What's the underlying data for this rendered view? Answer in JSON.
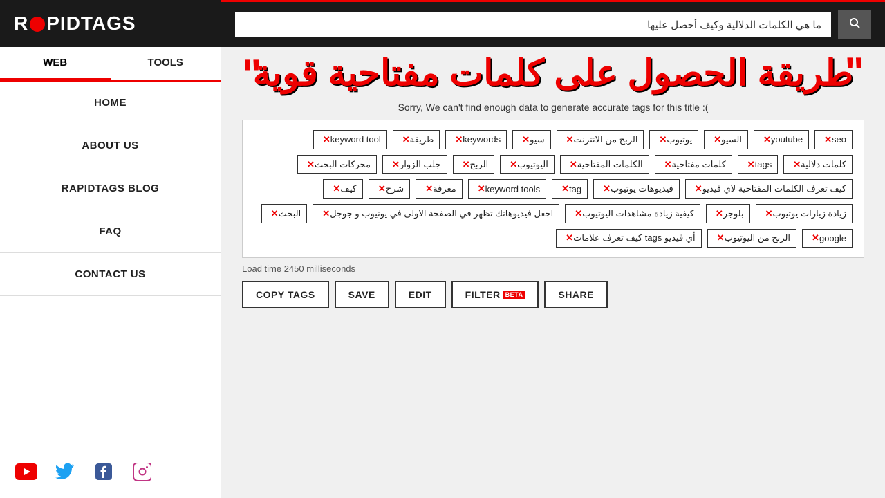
{
  "logo": {
    "text_before": "R",
    "text_after": "PIDTAGS"
  },
  "nav": {
    "tabs": [
      {
        "label": "WEB",
        "active": true
      },
      {
        "label": "TOOLS",
        "active": false
      }
    ],
    "menu_items": [
      {
        "label": "HOME"
      },
      {
        "label": "ABOUT US"
      },
      {
        "label": "RAPIDTAGS BLOG"
      },
      {
        "label": "FAQ"
      },
      {
        "label": "CONTACT US"
      }
    ]
  },
  "search": {
    "placeholder": "ما هي الكلمات الدلالية وكيف أحصل عليها",
    "value": "ما هي الكلمات الدلالية وكيف أحصل عليها"
  },
  "headline": {
    "arabic": "طريقة الحصول على كلمات مفتاحية قوية"
  },
  "sorry_message": "Sorry, We can't find enough data to generate accurate tags for this title :(",
  "tags": [
    {
      "text": "seo"
    },
    {
      "text": "youtube"
    },
    {
      "text": "السيو"
    },
    {
      "text": "يوتيوب"
    },
    {
      "text": "الربح من الانترنت"
    },
    {
      "text": "سيو"
    },
    {
      "text": "keywords"
    },
    {
      "text": "طريقة"
    },
    {
      "text": "keyword tool"
    },
    {
      "text": "كلمات دلالية"
    },
    {
      "text": "tags"
    },
    {
      "text": "كلمات مفتاحية"
    },
    {
      "text": "الكلمات المفتاحية"
    },
    {
      "text": "اليوتيوب"
    },
    {
      "text": "الربح"
    },
    {
      "text": "جلب الزوار"
    },
    {
      "text": "محركات البحث"
    },
    {
      "text": "كيف تعرف الكلمات المفتاحية لاي فيديو"
    },
    {
      "text": "فيديوهات يوتيوب"
    },
    {
      "text": "tag"
    },
    {
      "text": "keyword tools"
    },
    {
      "text": "معرفة"
    },
    {
      "text": "شرح"
    },
    {
      "text": "كيف"
    },
    {
      "text": "زيادة زيارات يوتيوب"
    },
    {
      "text": "بلوجر"
    },
    {
      "text": "كيفية زيادة مشاهدات اليوتيوب"
    },
    {
      "text": "اجعل فيديوهاتك تظهر في الصفحة الاولى في يوتيوب و جوجل"
    },
    {
      "text": "البحث"
    },
    {
      "text": "google"
    },
    {
      "text": "الربح من اليوتيوب"
    },
    {
      "text": "أي فيديو tags كيف تعرف علامات"
    }
  ],
  "load_time": "Load time 2450 milliseconds",
  "buttons": {
    "copy_tags": "COPY TAGS",
    "save": "SAVE",
    "edit": "EDIT",
    "filter": "FILTER",
    "filter_badge": "BETA",
    "share": "SHARE"
  },
  "social": {
    "youtube_color": "#e00",
    "twitter_color": "#1da1f2",
    "facebook_color": "#3b5998",
    "instagram_color": "#c13584"
  }
}
